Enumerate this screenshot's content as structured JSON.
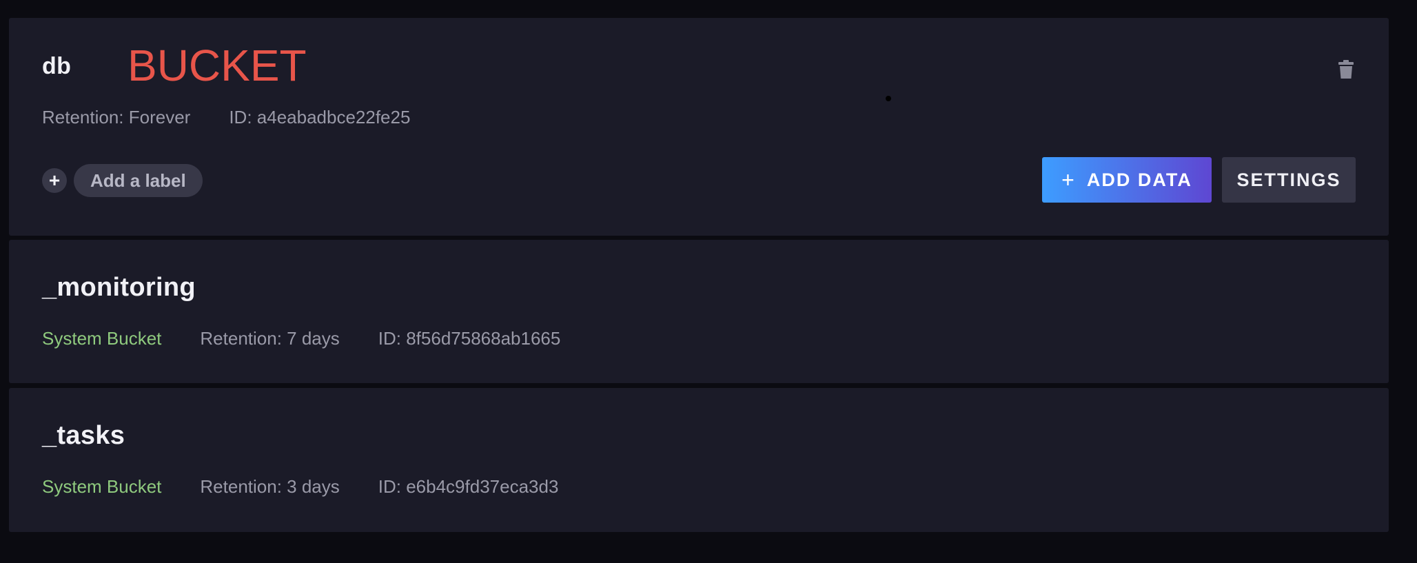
{
  "buckets": [
    {
      "name": "db",
      "retention": "Retention: Forever",
      "id": "ID: a4eabadbce22fe25",
      "add_label": "Add a label",
      "add_label_plus": "+",
      "add_data_plus": "+",
      "add_data_label": "ADD DATA",
      "settings_label": "SETTINGS",
      "annotation": "BUCKET"
    },
    {
      "name": "_monitoring",
      "type": "System Bucket",
      "retention": "Retention: 7 days",
      "id": "ID: 8f56d75868ab1665"
    },
    {
      "name": "_tasks",
      "type": "System Bucket",
      "retention": "Retention: 3 days",
      "id": "ID: e6b4c9fd37eca3d3"
    }
  ],
  "icons": {
    "delete": "trash-icon"
  },
  "colors": {
    "page_background": "#0b0b11",
    "card_background": "#1b1b28",
    "system_bucket": "#8fca7e",
    "annotation": "#e8554a",
    "add_data_gradient_start": "#3d9dff",
    "add_data_gradient_end": "#5e47d2"
  }
}
